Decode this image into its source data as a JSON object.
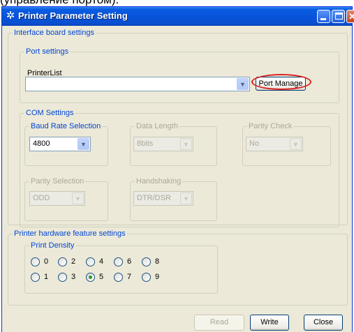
{
  "caption": "(управление портом).",
  "window": {
    "title": "Printer Parameter Setting"
  },
  "interface_group": {
    "legend": "Interface board settings"
  },
  "port_settings": {
    "legend": "Port settings",
    "printer_list_label": "PrinterList",
    "printer_list_value": "",
    "port_manage_label": "Port Manage"
  },
  "com_settings": {
    "legend": "COM Settings",
    "baud_rate": {
      "legend": "Baud Rate Selection",
      "value": "4800"
    },
    "data_length": {
      "legend": "Data Length",
      "value": "8bits"
    },
    "parity_check": {
      "legend": "Parity Check",
      "value": "No"
    },
    "parity_selection": {
      "legend": "Parity Selection",
      "value": "ODD"
    },
    "handshaking": {
      "legend": "Handshaking",
      "value": "DTR/DSR"
    }
  },
  "hardware": {
    "legend": "Printer hardware feature settings",
    "density_legend": "Print Density",
    "density_options": [
      "0",
      "2",
      "4",
      "6",
      "8",
      "1",
      "3",
      "5",
      "7",
      "9"
    ],
    "selected_density": "5"
  },
  "buttons": {
    "read": "Read",
    "write": "Write",
    "close": "Close"
  },
  "colors": {
    "titlebar": "#0753d9",
    "legend_text": "#0046d5",
    "highlight": "#d82020",
    "radio_selected": "#21a121"
  }
}
